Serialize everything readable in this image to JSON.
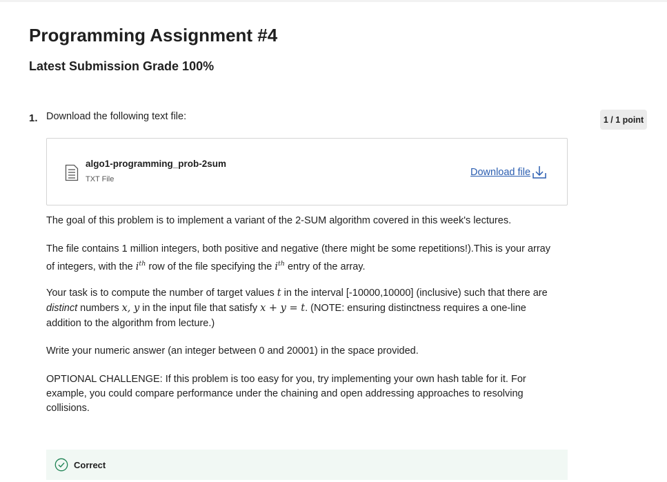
{
  "header": {
    "title": "Programming Assignment #4",
    "grade": "Latest Submission Grade 100%"
  },
  "question": {
    "number": "1.",
    "prompt": "Download the following text file:",
    "points": "1 / 1 point",
    "file": {
      "name": "algo1-programming_prob-2sum",
      "type": "TXT File",
      "icon": "document-icon",
      "download_label": "Download file",
      "download_icon": "download-icon"
    },
    "p1": "The goal of this problem is to implement a variant of the 2-SUM algorithm covered in this week's lectures.",
    "p2": {
      "line1": "The file contains 1 million integers, both positive and negative (there might be some repetitions!).This is your array",
      "part_a": "of integers, with the ",
      "i1": "i",
      "sup1": "th",
      "part_b": " row of the file specifying the ",
      "i2": "i",
      "sup2": "th",
      "part_c": " entry of the array."
    },
    "p3": {
      "part_a": "Your task is to compute the number of target values ",
      "t1": "t",
      "part_b": " in the interval [-10000,10000] (inclusive) such that there are",
      "distinct": "distinct",
      "part_c": " numbers ",
      "xy": "x, y",
      "part_d": " in the input file that satisfy ",
      "eq": "x + y = t",
      "part_e": ". (NOTE: ensuring distinctness requires a one-line",
      "line3": "addition to the algorithm from lecture.)"
    },
    "p4": "Write your numeric answer (an integer between 0 and 20001) in the space provided.",
    "p5": {
      "line1": "OPTIONAL CHALLENGE: If this problem is too easy for you, try implementing your own hash table for it. For",
      "line2": "example, you could compare performance under the chaining and open addressing approaches to resolving",
      "line3": "collisions."
    },
    "feedback": {
      "label": "Correct",
      "icon": "check-circle-icon",
      "color": "#1f8354"
    }
  },
  "colors": {
    "link": "#2a5db0",
    "badge_bg": "#ebebeb",
    "correct_bg": "#f1f8f4"
  }
}
